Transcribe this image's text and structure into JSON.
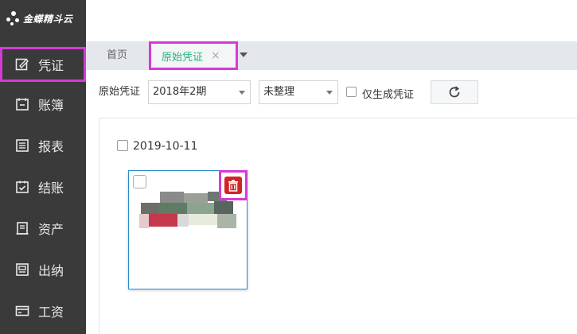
{
  "app": {
    "logo_text": "金蝶精斗云"
  },
  "sidebar": {
    "items": [
      {
        "label": "凭证",
        "icon": "edit-icon",
        "highlighted": true
      },
      {
        "label": "账簿",
        "icon": "ledger-icon"
      },
      {
        "label": "报表",
        "icon": "report-icon"
      },
      {
        "label": "结账",
        "icon": "checkout-icon"
      },
      {
        "label": "资产",
        "icon": "assets-icon"
      },
      {
        "label": "出纳",
        "icon": "cashier-icon"
      },
      {
        "label": "工资",
        "icon": "salary-icon"
      }
    ]
  },
  "tabs": {
    "home_label": "首页",
    "active_label": "原始凭证",
    "close_glyph": "×"
  },
  "filters": {
    "label": "原始凭证",
    "period_value": "2018年2期",
    "status_value": "未整理",
    "only_generated_label": "仅生成凭证",
    "only_generated_checked": false
  },
  "content": {
    "date_label": "2019-10-11",
    "date_checked": false
  },
  "colors": {
    "sidebar_bg": "#3a3a3a",
    "accent_green": "#25b27a",
    "highlight_magenta": "#d63ad6",
    "delete_red": "#d32424",
    "card_border": "#2a8bc9"
  }
}
